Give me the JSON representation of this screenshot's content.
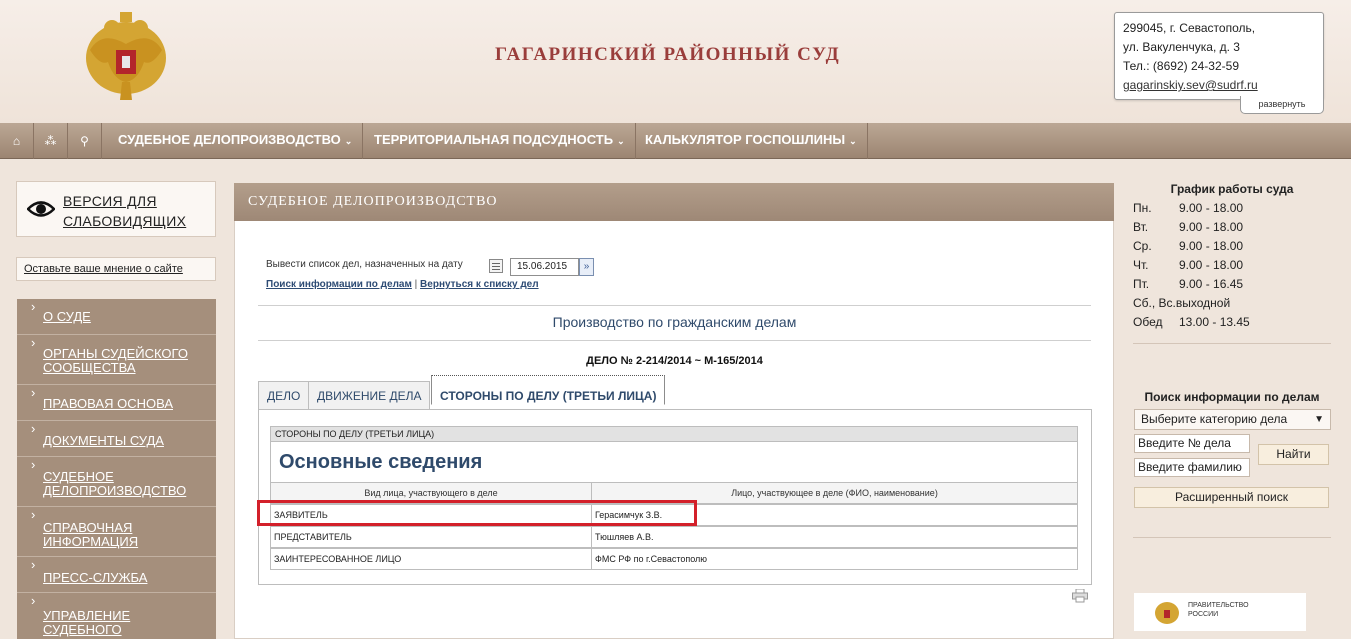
{
  "header": {
    "court_title": "ГАГАРИНСКИЙ РАЙОННЫЙ СУД",
    "address_line1": "299045, г. Севастополь,",
    "address_line2": "ул. Вакуленчука, д. 3",
    "phone": "Тел.: (8692) 24-32-59",
    "email": "gagarinskiy.sev@sudrf.ru",
    "expand_label": "развернуть"
  },
  "nav": {
    "icons": [
      "home-icon",
      "sitemap-icon",
      "search-icon"
    ],
    "items": [
      {
        "label": "СУДЕБНОЕ ДЕЛОПРОИЗВОДСТВО"
      },
      {
        "label": "ТЕРРИТОРИАЛЬНАЯ ПОДСУДНОСТЬ"
      },
      {
        "label": "КАЛЬКУЛЯТОР ГОСПОШЛИНЫ"
      }
    ]
  },
  "left": {
    "low_vision_line1": "ВЕРСИЯ ДЛЯ",
    "low_vision_line2": "СЛАБОВИДЯЩИХ",
    "feedback": "Оставьте ваше мнение о сайте",
    "menu": [
      {
        "l1": "О СУДЕ",
        "l2": ""
      },
      {
        "l1": "ОРГАНЫ СУДЕЙСКОГО",
        "l2": "СООБЩЕСТВА"
      },
      {
        "l1": "ПРАВОВАЯ ОСНОВА",
        "l2": ""
      },
      {
        "l1": "ДОКУМЕНТЫ СУДА",
        "l2": ""
      },
      {
        "l1": "СУДЕБНОЕ",
        "l2": "ДЕЛОПРОИЗВОДСТВО"
      },
      {
        "l1": "СПРАВОЧНАЯ",
        "l2": "ИНФОРМАЦИЯ"
      },
      {
        "l1": "ПРЕСС-СЛУЖБА",
        "l2": ""
      },
      {
        "l1": "УПРАВЛЕНИЕ",
        "l2": "СУДЕБНОГО"
      }
    ]
  },
  "main": {
    "section_title": "СУДЕБНОЕ ДЕЛОПРОИЗВОДСТВО",
    "date_label": "Вывести список дел, назначенных на дату",
    "date_value": "15.06.2015",
    "link_search": "Поиск информации по делам",
    "link_separator": "|",
    "link_back": "Вернуться к списку дел",
    "proceeding_title": "Производство по гражданским делам",
    "case_number": "ДЕЛО № 2-214/2014 ~ М-165/2014",
    "tabs": [
      {
        "label": "ДЕЛО"
      },
      {
        "label": "ДВИЖЕНИЕ ДЕЛА"
      },
      {
        "label": "СТОРОНЫ ПО ДЕЛУ (ТРЕТЬИ ЛИЦА)"
      }
    ],
    "table_caption": "СТОРОНЫ ПО ДЕЛУ (ТРЕТЬИ ЛИЦА)",
    "table_heading": "Основные сведения",
    "col1": "Вид лица, участвующего в деле",
    "col2": "Лицо, участвующее в деле (ФИО, наименование)",
    "rows": [
      {
        "type": "ЗАЯВИТЕЛЬ",
        "person": "Герасимчук З.В."
      },
      {
        "type": "ПРЕДСТАВИТЕЛЬ",
        "person": "Тюшляев А.В."
      },
      {
        "type": "ЗАИНТЕРЕСОВАННОЕ ЛИЦО",
        "person": "ФМС РФ по г.Севастополю"
      }
    ]
  },
  "right": {
    "schedule_title": "График работы суда",
    "schedule": [
      {
        "day": "Пн.",
        "hours": "9.00 - 18.00"
      },
      {
        "day": "Вт.",
        "hours": "9.00 - 18.00"
      },
      {
        "day": "Ср.",
        "hours": "9.00 - 18.00"
      },
      {
        "day": "Чт.",
        "hours": "9.00 - 18.00"
      },
      {
        "day": "Пт.",
        "hours": "9.00 - 16.45"
      },
      {
        "day": "Сб., Вс.",
        "hours": "выходной"
      },
      {
        "day": "Обед",
        "hours": "13.00 - 13.45"
      }
    ],
    "search_title": "Поиск информации по делам",
    "category_placeholder": "Выберите категорию дела",
    "case_no_placeholder": "Введите № дела",
    "surname_placeholder": "Введите фамилию",
    "find_button": "Найти",
    "advanced_button": "Расширенный поиск",
    "gov_line1": "ПРАВИТЕЛЬСТВО",
    "gov_line2": "РОССИИ"
  },
  "colors": {
    "accent_title": "#9a3d3b",
    "nav_bg": "#a89381",
    "highlight": "#d3202a",
    "link": "#2f4a6b"
  }
}
